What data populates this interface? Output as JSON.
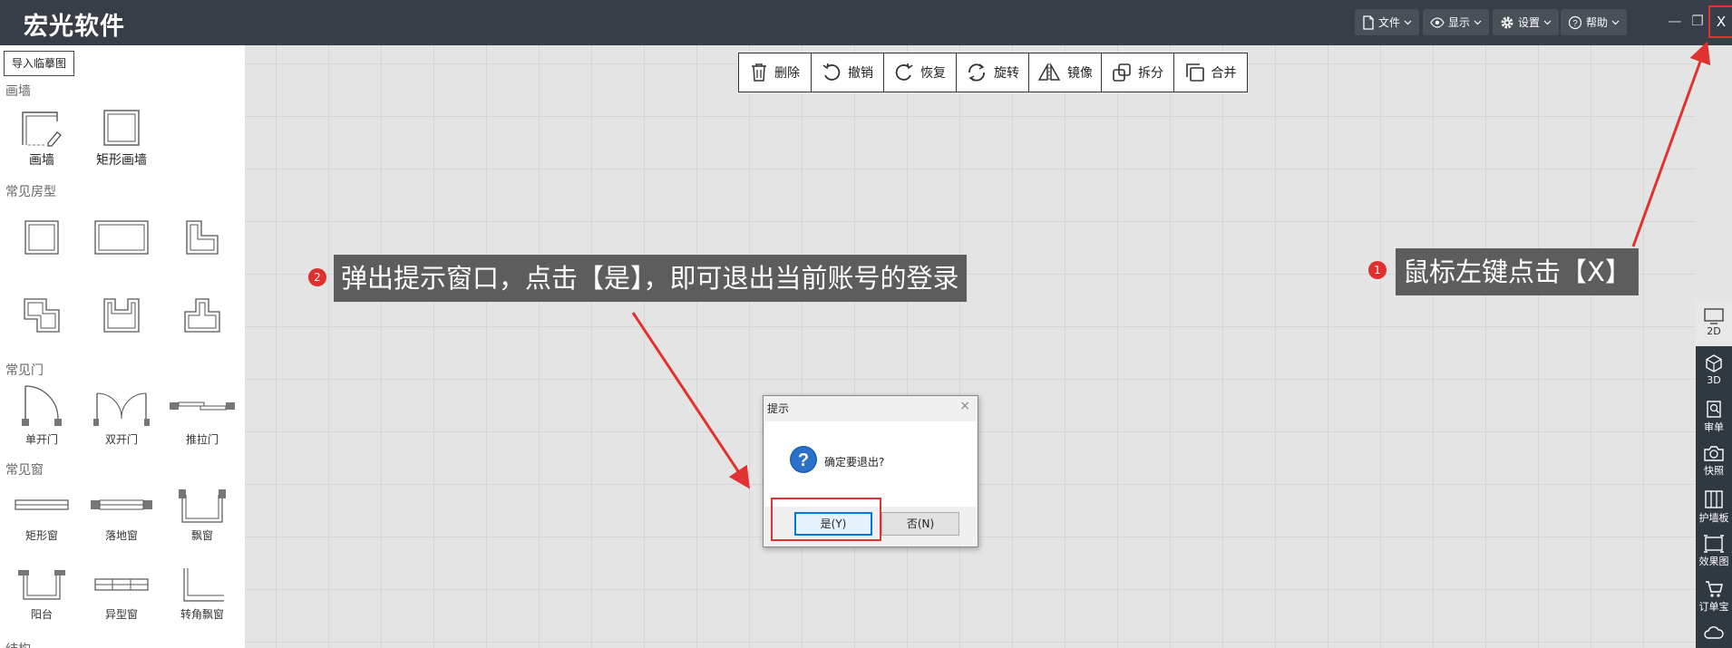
{
  "app": {
    "title": "宏光软件"
  },
  "header_menu": [
    {
      "label": "文件",
      "icon": "file-icon"
    },
    {
      "label": "显示",
      "icon": "eye-icon"
    },
    {
      "label": "设置",
      "icon": "gear-icon"
    },
    {
      "label": "帮助",
      "icon": "help-icon"
    }
  ],
  "window_controls": {
    "minimize": "—",
    "restore": "❐",
    "close": "X"
  },
  "left_panel": {
    "import_button": "导入临摹图",
    "sections": {
      "wall": "画墙",
      "rooms": "常见房型",
      "doors": "常见门",
      "windows": "常见窗",
      "structure": "结构"
    },
    "wall_items": [
      "画墙",
      "矩形画墙"
    ],
    "door_items": [
      "单开门",
      "双开门",
      "推拉门"
    ],
    "window_items": [
      "矩形窗",
      "落地窗",
      "飘窗",
      "阳台",
      "异型窗",
      "转角飘窗"
    ]
  },
  "toolbar": [
    {
      "label": "删除",
      "icon": "trash-icon"
    },
    {
      "label": "撤销",
      "icon": "undo-icon"
    },
    {
      "label": "恢复",
      "icon": "redo-icon"
    },
    {
      "label": "旋转",
      "icon": "rotate-icon"
    },
    {
      "label": "镜像",
      "icon": "mirror-icon"
    },
    {
      "label": "拆分",
      "icon": "split-icon"
    },
    {
      "label": "合并",
      "icon": "merge-icon"
    }
  ],
  "right_bar": [
    {
      "label": "2D",
      "icon": "monitor-icon"
    },
    {
      "label": "3D",
      "icon": "cube-icon"
    },
    {
      "label": "审单",
      "icon": "review-icon"
    },
    {
      "label": "快照",
      "icon": "camera-icon"
    },
    {
      "label": "护墙板",
      "icon": "panel-icon"
    },
    {
      "label": "效果图",
      "icon": "render-icon"
    },
    {
      "label": "订单宝",
      "icon": "cart-icon"
    },
    {
      "label": "",
      "icon": "cloud-icon"
    }
  ],
  "annotations": {
    "step1": {
      "badge": "1",
      "text": "鼠标左键点击【X】"
    },
    "step2": {
      "badge": "2",
      "text": "弹出提示窗口，点击【是】，即可退出当前账号的登录"
    }
  },
  "dialog": {
    "title": "提示",
    "message": "确定要退出?",
    "yes_label": "是(Y)",
    "no_label": "否(N)",
    "close_glyph": "×"
  },
  "colors": {
    "header_bg": "#383e47",
    "annotation_red": "#e23131",
    "callout_bg": "#5d5d5d",
    "dialog_accent": "#0078d7"
  }
}
